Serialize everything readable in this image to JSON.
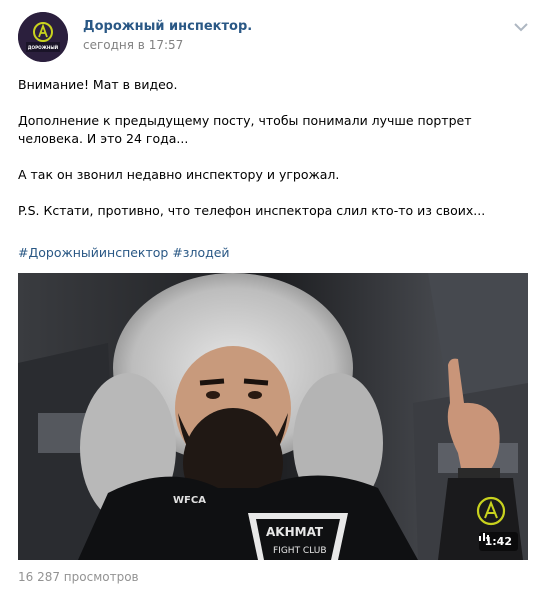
{
  "post": {
    "author": "Дорожный инспектор.",
    "time": "сегодня в 17:57",
    "avatar_logo_text": "ДОРОЖНЫЙ ИНСПЕКТОР",
    "paragraphs": [
      "Внимание! Мат в видео.",
      "Дополнение к предыдущему посту, чтобы понимали лучше портрет человека. И это 24 года...",
      "А так он звонил недавно инспектору и угрожал.",
      "P.S. Кстати, противно, что телефон инспектора слил кто-то из своих..."
    ],
    "tags": [
      "#Дорожныйинспектор",
      "#злодей"
    ],
    "video": {
      "duration": "1:42",
      "shirt_text": [
        "WFCA",
        "AKHMAT",
        "FIGHT CLUB"
      ]
    },
    "views": "16 287 просмотров"
  },
  "colors": {
    "link": "#2a5885",
    "meta": "#828282",
    "logo_accent": "#c8d21e"
  },
  "icons": [
    "avatar-logo",
    "chevron-down-icon",
    "video-bars-icon",
    "channel-logo-icon"
  ]
}
